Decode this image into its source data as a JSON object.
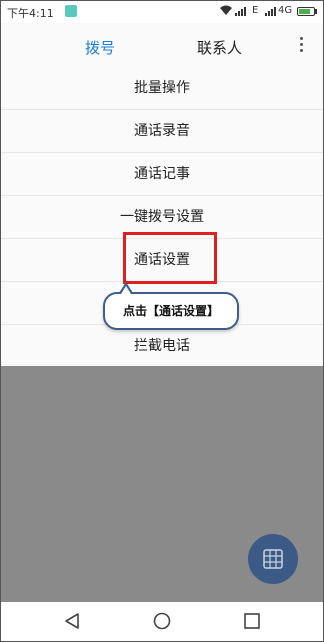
{
  "status_bar": {
    "time": "下午4:11",
    "network_1": "E",
    "network_2": "4G",
    "battery_level": 0.8
  },
  "top_bar": {
    "tab_dial": "拨号",
    "tab_contacts": "联系人",
    "active_tab_color": "#1a7fd4",
    "more_icon": "more-vertical-icon"
  },
  "menu": {
    "items": [
      {
        "label": "批量操作"
      },
      {
        "label": "通话录音"
      },
      {
        "label": "通话记事"
      },
      {
        "label": "一键拨号设置"
      },
      {
        "label": "通话设置"
      },
      {
        "label": ""
      },
      {
        "label": "拦截电话"
      }
    ]
  },
  "annotation": {
    "callout_text": "点击【通话设置】",
    "highlight_color": "#e02020"
  },
  "fab": {
    "icon": "dialpad-icon",
    "color": "#3b5a86"
  },
  "nav_bar": {
    "back_icon": "back-triangle-icon",
    "home_icon": "home-circle-icon",
    "recent_icon": "recent-square-icon"
  }
}
